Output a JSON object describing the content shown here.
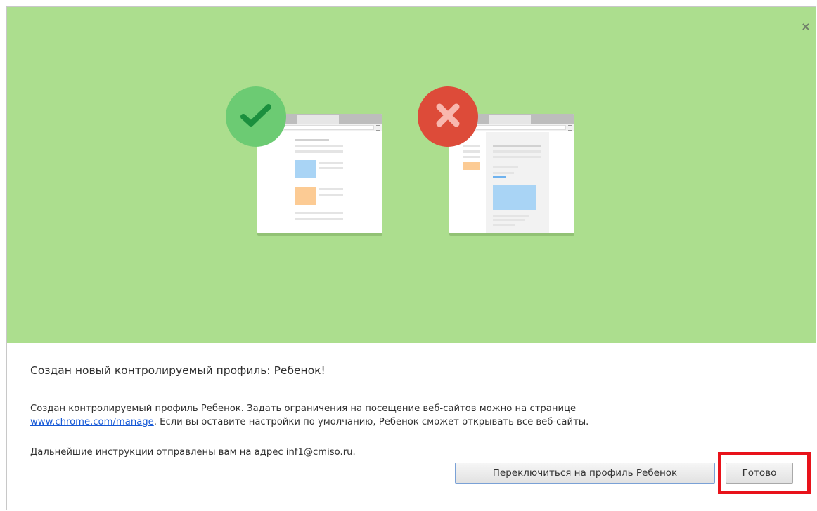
{
  "dialog": {
    "close_label": "×",
    "heading": "Создан новый контролируемый профиль: Ребенок!",
    "paragraph1_before_link": "Создан контролируемый профиль Ребенок. Задать ограничения на посещение веб-сайтов можно на странице",
    "paragraph1_link": "www.chrome.com/manage",
    "paragraph1_after_link": ". Если вы оставите настройки по умолчанию, Ребенок сможет открывать все веб-сайты.",
    "paragraph2": "Дальнейшие инструкции отправлены вам на адрес inf1@cmiso.ru.",
    "switch_button": "Переключиться на профиль Ребенок",
    "done_button": "Готово"
  },
  "hero": {
    "allowed_icon": "checkmark-icon",
    "blocked_icon": "cross-icon"
  },
  "colors": {
    "hero_bg": "#acde8e",
    "allowed_badge": "#6ccb73",
    "blocked_badge": "#dd4b39",
    "link": "#1558d6",
    "highlight": "#e8121a"
  }
}
